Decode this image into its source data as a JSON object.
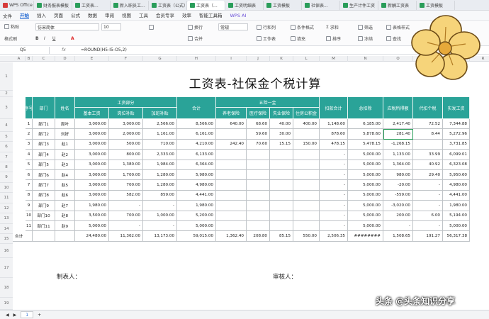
{
  "tabs": [
    "WPS Office",
    "财务报表模板",
    "工资表...",
    "新入职员工...",
    "工资表（公式）",
    "工资表（...",
    "工资明细表",
    "工资模板",
    "社保表...",
    "生产计件工资",
    "新酬工资表",
    "工资模板"
  ],
  "menu": {
    "file": "文件",
    "items": [
      "开始",
      "插入",
      "页面",
      "公式",
      "数据",
      "审阅",
      "视图",
      "工具",
      "会员专享",
      "效率",
      "智能工具箱"
    ],
    "active": "开始",
    "ai": "WPS AI"
  },
  "ribbon": {
    "font_name": "仿宋简体",
    "font_size": "10",
    "format_painter": "格式刷",
    "paste": "粘贴",
    "wrap": "换行",
    "merge": "合并",
    "number_format": "常规",
    "row_col": "行和列",
    "worksheet": "工作表",
    "conditional": "条件格式",
    "fill": "填充",
    "sort": "排序",
    "sum": "求和",
    "filter": "筛选",
    "freeze": "冻结",
    "find": "查找",
    "table_style": "表格样式"
  },
  "formula_bar": {
    "cell_ref": "Q5",
    "fx": "fx",
    "formula": "=ROUND(H5-I5-O5,2)"
  },
  "columns": [
    "A",
    "B",
    "C",
    "D",
    "E",
    "F",
    "G",
    "H",
    "I",
    "J",
    "K",
    "L",
    "M",
    "N",
    "O",
    "P",
    "Q",
    "R",
    "S"
  ],
  "title": "工资表-社保金个税计算",
  "headers": {
    "seq": "序号",
    "dept": "部门",
    "name": "姓名",
    "wage_group": "工资部分",
    "basic": "基本工资",
    "post": "岗位补贴",
    "overtime": "加班补贴",
    "total": "合计",
    "insurance_group": "五险一金",
    "pension": "养老保险",
    "medical": "医疗保险",
    "unemployment": "失业保险",
    "housing": "住房公积金",
    "deduct_total": "扣款合计",
    "exemption": "总扣除",
    "taxable": "应税所得额",
    "withheld": "代扣个税",
    "net": "实发工资"
  },
  "rows": [
    [
      "1",
      "部门1",
      "周叶",
      "3,000.00",
      "3,000.00",
      "2,566.00",
      "8,566.00",
      "640.00",
      "68.60",
      "40.00",
      "400.00",
      "1,148.60",
      "6,185.00",
      "2,417.40",
      "72.52",
      "7,344.88"
    ],
    [
      "2",
      "部门2",
      "刘好",
      "3,000.00",
      "2,000.00",
      "1,161.00",
      "6,161.00",
      "",
      "59.60",
      "30.00",
      "",
      "878.60",
      "5,878.60",
      "281.40",
      "8.44",
      "5,272.96"
    ],
    [
      "3",
      "部门3",
      "赵1",
      "3,000.00",
      "500.00",
      "710.00",
      "4,210.00",
      "242.40",
      "70.60",
      "15.15",
      "150.00",
      "478.15",
      "5,478.15",
      "-1,268.15",
      "",
      "3,731.85"
    ],
    [
      "4",
      "部门4",
      "赵2",
      "3,000.00",
      "800.00",
      "2,333.00",
      "6,133.00",
      "",
      "",
      "",
      "",
      "-",
      "5,000.00",
      "1,133.00",
      "33.99",
      "6,099.01"
    ],
    [
      "5",
      "部门5",
      "赵3",
      "3,000.00",
      "1,380.00",
      "1,984.00",
      "6,364.00",
      "",
      "",
      "",
      "",
      "-",
      "5,000.00",
      "1,364.00",
      "40.92",
      "6,323.08"
    ],
    [
      "6",
      "部门6",
      "赵4",
      "3,000.00",
      "1,700.00",
      "1,280.00",
      "5,980.00",
      "",
      "",
      "",
      "",
      "-",
      "5,000.00",
      "980.00",
      "29.40",
      "5,950.60"
    ],
    [
      "7",
      "部门7",
      "赵5",
      "3,000.00",
      "700.00",
      "1,280.00",
      "4,980.00",
      "",
      "",
      "",
      "",
      "-",
      "5,000.00",
      "-20.00",
      "-",
      "4,980.00"
    ],
    [
      "8",
      "部门8",
      "赵6",
      "3,000.00",
      "582.00",
      "859.00",
      "4,441.00",
      "",
      "",
      "",
      "",
      "-",
      "5,000.00",
      "-559.00",
      "-",
      "4,441.00"
    ],
    [
      "9",
      "部门9",
      "赵7",
      "1,980.00",
      "-",
      "-",
      "1,980.00",
      "",
      "",
      "",
      "",
      "-",
      "5,000.00",
      "-3,020.00",
      "-",
      "1,980.00"
    ],
    [
      "10",
      "部门10",
      "赵8",
      "3,500.00",
      "700.00",
      "1,000.00",
      "5,200.00",
      "",
      "",
      "",
      "",
      "-",
      "5,000.00",
      "200.00",
      "6.00",
      "5,194.00"
    ],
    [
      "11",
      "部门11",
      "赵9",
      "5,000.00",
      "-",
      "-",
      "5,000.00",
      "",
      "",
      "",
      "",
      "-",
      "5,000.00",
      "-",
      "-",
      "5,000.00"
    ]
  ],
  "total_row": [
    "合计",
    "",
    "",
    "24,480.00",
    "11,362.00",
    "13,173.00",
    "59,015.00",
    "1,362.40",
    "208.80",
    "85.15",
    "550.00",
    "2,506.35",
    "########",
    "1,508.65",
    "191.27",
    "56,317.38"
  ],
  "row_numbers": [
    "1",
    "2",
    "3",
    "4",
    "5",
    "6",
    "7",
    "8",
    "9",
    "10",
    "11",
    "12",
    "13",
    "14",
    "15",
    "16",
    "17",
    "18",
    "19"
  ],
  "sign": {
    "maker": "制表人：",
    "reviewer": "审核人："
  },
  "sheet": {
    "tab": "1",
    "add": "+"
  },
  "watermark": "头条 @头条知识分享",
  "colors": {
    "header_bg": "#2aa398",
    "accent": "#2a6ed4"
  }
}
